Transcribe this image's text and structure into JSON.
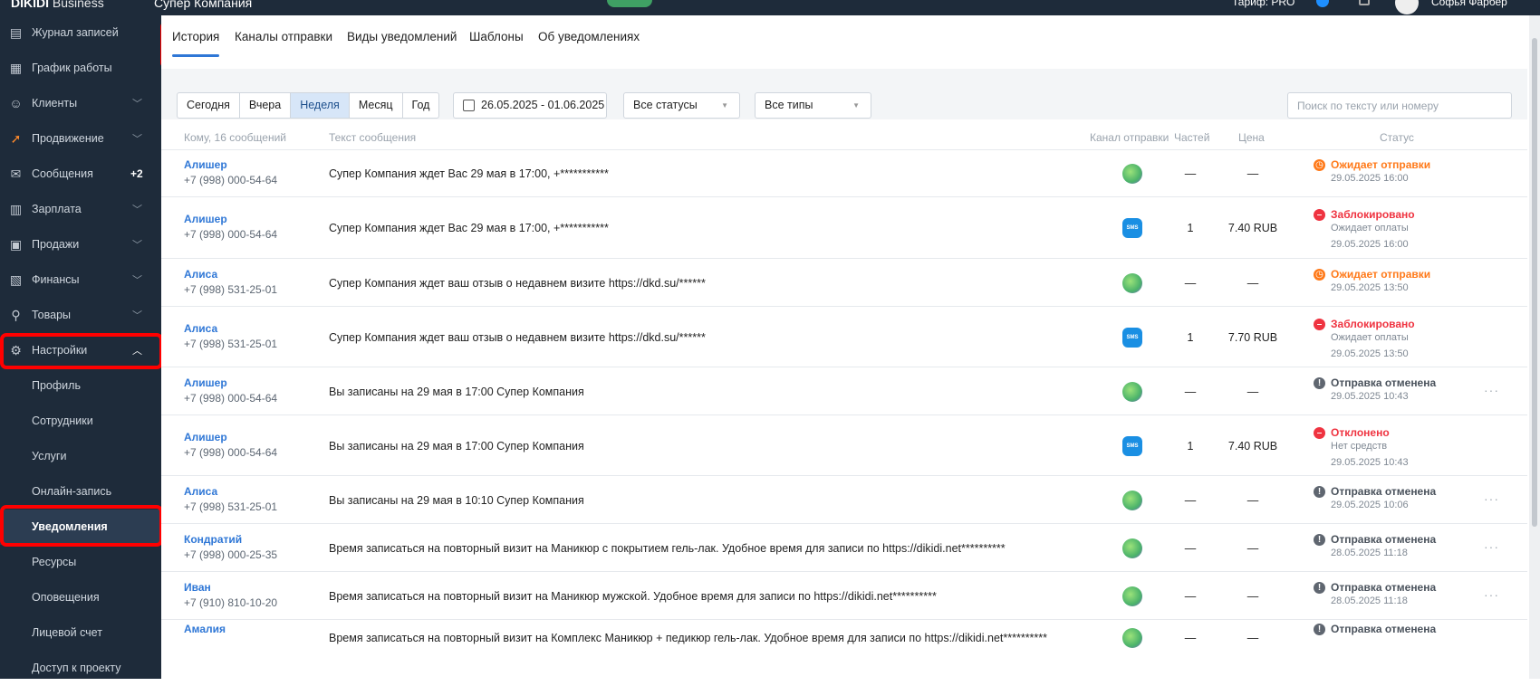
{
  "topbar": {
    "brand": "DIKIDI",
    "brand_sub": "Business",
    "company": "Супер Компания",
    "tariff": "Тариф: PRO",
    "user": "Софья Фарбер"
  },
  "sidebar": {
    "items": [
      {
        "label": "Журнал записей",
        "icon": "journal-icon",
        "badge": "",
        "has_chevron": false
      },
      {
        "label": "График работы",
        "icon": "calendar-icon",
        "badge": "",
        "has_chevron": false
      },
      {
        "label": "Клиенты",
        "icon": "clients-icon",
        "badge": "",
        "has_chevron": true
      },
      {
        "label": "Продвижение",
        "icon": "rocket-icon",
        "badge": "",
        "has_chevron": true
      },
      {
        "label": "Сообщения",
        "icon": "messages-icon",
        "badge": "+2",
        "has_chevron": false
      },
      {
        "label": "Зарплата",
        "icon": "salary-icon",
        "badge": "",
        "has_chevron": true
      },
      {
        "label": "Продажи",
        "icon": "sales-icon",
        "badge": "",
        "has_chevron": true
      },
      {
        "label": "Финансы",
        "icon": "finance-icon",
        "badge": "",
        "has_chevron": true
      },
      {
        "label": "Товары",
        "icon": "goods-icon",
        "badge": "",
        "has_chevron": true
      },
      {
        "label": "Настройки",
        "icon": "gear-icon",
        "badge": "",
        "has_chevron": true
      }
    ],
    "settings_sub": [
      {
        "label": "Профиль",
        "active": false
      },
      {
        "label": "Сотрудники",
        "active": false
      },
      {
        "label": "Услуги",
        "active": false
      },
      {
        "label": "Онлайн-запись",
        "active": false
      },
      {
        "label": "Уведомления",
        "active": true
      },
      {
        "label": "Ресурсы",
        "active": false
      },
      {
        "label": "Оповещения",
        "active": false
      },
      {
        "label": "Лицевой счет",
        "active": false
      },
      {
        "label": "Доступ к проекту",
        "active": false
      }
    ]
  },
  "tabs": [
    "История",
    "Каналы отправки",
    "Виды уведомлений",
    "Шаблоны",
    "Об уведомлениях"
  ],
  "filters": {
    "periods": [
      "Сегодня",
      "Вчера",
      "Неделя",
      "Месяц",
      "Год"
    ],
    "active_period": "Неделя",
    "date_range": "26.05.2025 - 01.06.2025",
    "status_select": "Все статусы",
    "type_select": "Все типы",
    "search_placeholder": "Поиск по тексту или номеру"
  },
  "table": {
    "headers": [
      "Кому, 16 сообщений",
      "Текст сообщения",
      "Канал отправки",
      "Частей",
      "Цена",
      "Статус"
    ],
    "rows": [
      {
        "name": "Алишер",
        "phone": "+7 (998) 000-54-64",
        "text": "Супер Компания ждет Вас 29 мая в 17:00, +***********",
        "channel": "whatsapp",
        "parts": "—",
        "price": "—",
        "status": "Ожидает отправки",
        "status_color": "#ff7a1a",
        "status_kind": "orange",
        "status_sub": "",
        "date": "29.05.2025 16:00",
        "more": false
      },
      {
        "name": "Алишер",
        "phone": "+7 (998) 000-54-64",
        "text": "Супер Компания ждет Вас 29 мая в 17:00, +***********",
        "channel": "sms",
        "parts": "1",
        "price": "7.40 RUB",
        "status": "Заблокировано",
        "status_color": "#ef3340",
        "status_kind": "red",
        "status_sub": "Ожидает оплаты",
        "date": "29.05.2025 16:00",
        "more": false
      },
      {
        "name": "Алиса",
        "phone": "+7 (998) 531-25-01",
        "text": "Супер Компания ждет ваш отзыв о недавнем визите https://dkd.su/******",
        "channel": "whatsapp",
        "parts": "—",
        "price": "—",
        "status": "Ожидает отправки",
        "status_color": "#ff7a1a",
        "status_kind": "orange",
        "status_sub": "",
        "date": "29.05.2025 13:50",
        "more": false
      },
      {
        "name": "Алиса",
        "phone": "+7 (998) 531-25-01",
        "text": "Супер Компания ждет ваш отзыв о недавнем визите https://dkd.su/******",
        "channel": "sms",
        "parts": "1",
        "price": "7.70 RUB",
        "status": "Заблокировано",
        "status_color": "#ef3340",
        "status_kind": "red",
        "status_sub": "Ожидает оплаты",
        "date": "29.05.2025 13:50",
        "more": false
      },
      {
        "name": "Алишер",
        "phone": "+7 (998) 000-54-64",
        "text": "Вы записаны на 29 мая в 17:00 Супер Компания",
        "channel": "whatsapp",
        "parts": "—",
        "price": "—",
        "status": "Отправка отменена",
        "status_color": "#5f6670",
        "status_kind": "gray",
        "status_sub": "",
        "date": "29.05.2025 10:43",
        "more": true
      },
      {
        "name": "Алишер",
        "phone": "+7 (998) 000-54-64",
        "text": "Вы записаны на 29 мая в 17:00 Супер Компания",
        "channel": "sms",
        "parts": "1",
        "price": "7.40 RUB",
        "status": "Отклонено",
        "status_color": "#ef3340",
        "status_kind": "red",
        "status_sub": "Нет средств",
        "date": "29.05.2025 10:43",
        "more": false
      },
      {
        "name": "Алиса",
        "phone": "+7 (998) 531-25-01",
        "text": "Вы записаны на 29 мая в 10:10 Супер Компания",
        "channel": "whatsapp",
        "parts": "—",
        "price": "—",
        "status": "Отправка отменена",
        "status_color": "#5f6670",
        "status_kind": "gray",
        "status_sub": "",
        "date": "29.05.2025 10:06",
        "more": true
      },
      {
        "name": "Кондратий",
        "phone": "+7 (998) 000-25-35",
        "text": "Время записаться на повторный визит на Маникюр с покрытием гель-лак. Удобное время для записи по https://dikidi.net**********",
        "channel": "whatsapp",
        "parts": "—",
        "price": "—",
        "status": "Отправка отменена",
        "status_color": "#5f6670",
        "status_kind": "gray",
        "status_sub": "",
        "date": "28.05.2025 11:18",
        "more": true
      },
      {
        "name": "Иван",
        "phone": "+7 (910) 810-10-20",
        "text": "Время записаться на повторный визит на Маникюр мужской. Удобное время для записи по https://dikidi.net**********",
        "channel": "whatsapp",
        "parts": "—",
        "price": "—",
        "status": "Отправка отменена",
        "status_color": "#5f6670",
        "status_kind": "gray",
        "status_sub": "",
        "date": "28.05.2025 11:18",
        "more": true
      },
      {
        "name": "Амалия",
        "phone": "",
        "text": "Время записаться на повторный визит на Комплекс Маникюр + педикюр гель-лак. Удобное время для записи по https://dikidi.net**********",
        "channel": "whatsapp",
        "parts": "—",
        "price": "—",
        "status": "Отправка отменена",
        "status_color": "#5f6670",
        "status_kind": "gray",
        "status_sub": "",
        "date": "",
        "more": false
      }
    ]
  }
}
